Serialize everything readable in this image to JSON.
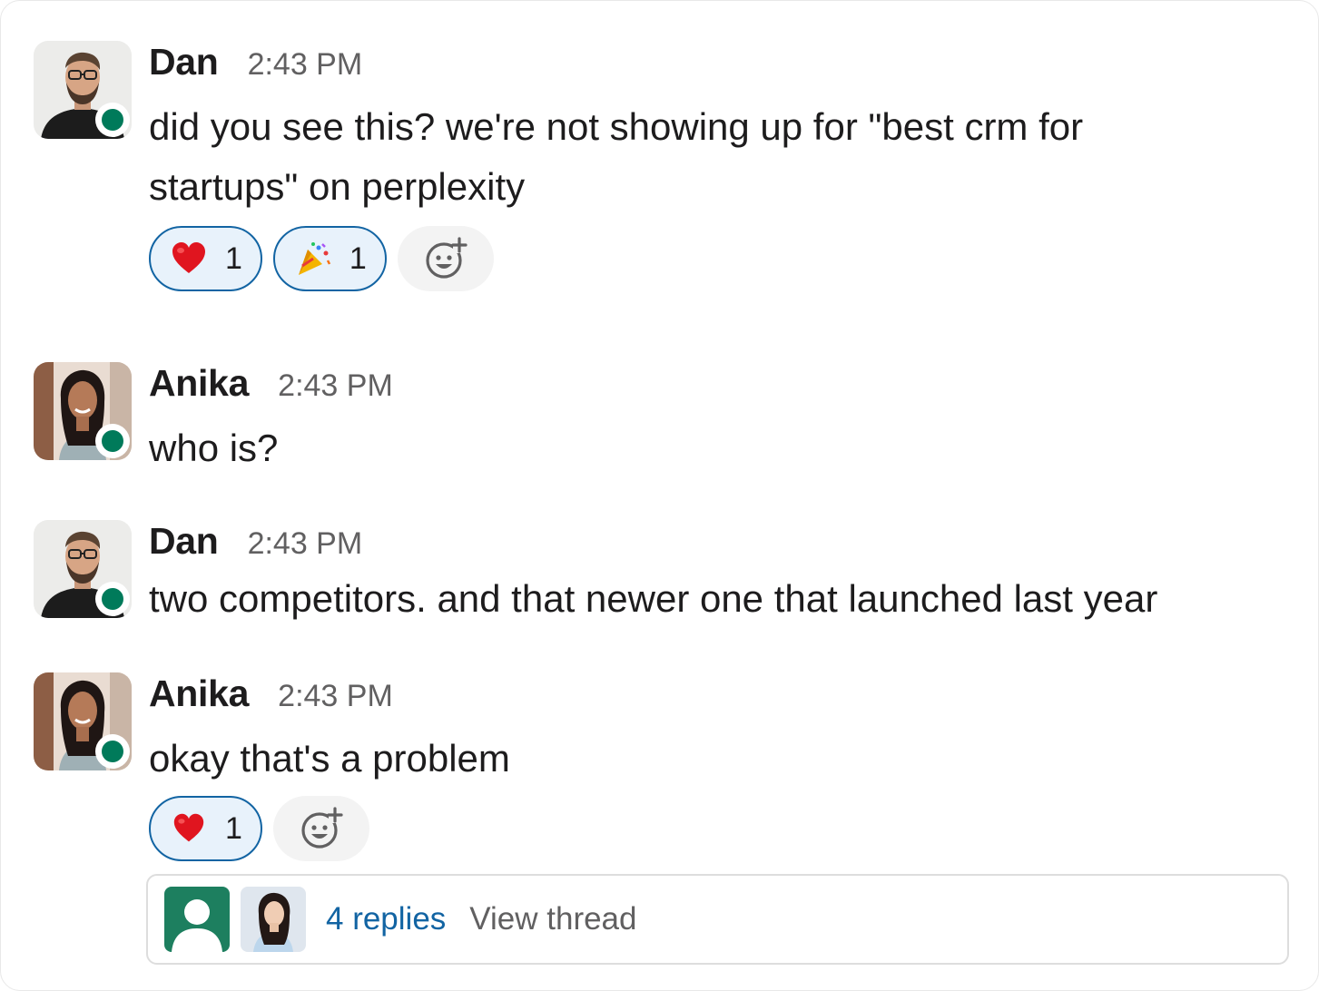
{
  "messages": [
    {
      "author": "Dan",
      "time": "2:43 PM",
      "text": "did you see this? we're not showing up for \"best crm for startups\" on perplexity",
      "reactions": [
        {
          "emoji": "heart-emoji",
          "count": "1"
        },
        {
          "emoji": "party-popper-emoji",
          "count": "1"
        }
      ]
    },
    {
      "author": "Anika",
      "time": "2:43 PM",
      "text": "who is?"
    },
    {
      "author": "Dan",
      "time": "2:43 PM",
      "text": "two competitors. and that newer one that launched last year"
    },
    {
      "author": "Anika",
      "time": "2:43 PM",
      "text": "okay that's a problem",
      "reactions": [
        {
          "emoji": "heart-emoji",
          "count": "1"
        }
      ],
      "thread": {
        "replies": "4 replies",
        "view": "View thread"
      }
    }
  ],
  "colors": {
    "presence": "#007a5a",
    "link": "#1264a3",
    "reaction_bg": "#e8f2fb",
    "reaction_border": "#1264a3",
    "muted": "#616061"
  },
  "icons": {
    "add_reaction": "add-emoji-icon",
    "default_avatar": "user-silhouette-icon"
  }
}
